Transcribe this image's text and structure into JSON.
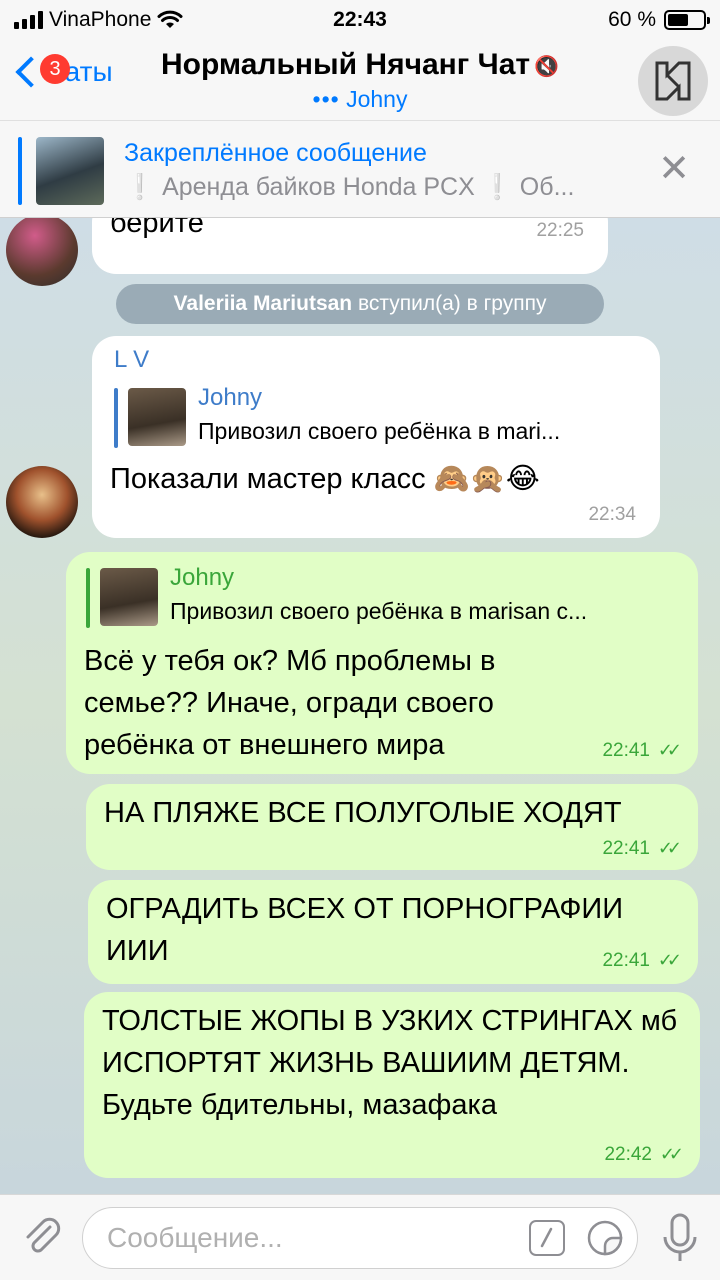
{
  "status_bar": {
    "carrier": "VinaPhone",
    "time": "22:43",
    "battery": "60 %",
    "battery_level": 0.6
  },
  "header": {
    "back_label": "Чаты",
    "unread_badge": "3",
    "chat_title": "Нормальный Нячанг Чат",
    "typing_dots": "•••",
    "typing_user": "Johny"
  },
  "pinned": {
    "title": "Закреплённое сообщение",
    "text": "❕ Аренда байков Honda PCX ❕ Об..."
  },
  "messages": [
    {
      "text": "берите",
      "time": "22:25"
    },
    {
      "service_name": "Valeriia Mariutsan",
      "service_text": " вступил(а) в группу"
    },
    {
      "sender": "L V",
      "reply_name": "Johny",
      "reply_text": "Привозил своего ребёнка в mari...",
      "text": "Показали мастер класс 🙈🙊😂",
      "time": "22:34"
    },
    {
      "reply_name": "Johny",
      "reply_text": "Привозил своего ребёнка в marisan c...",
      "text": "Всё у тебя ок? Мб проблемы в семье?? Иначе, огради своего ребёнка от внешнего мира",
      "time": "22:41",
      "checks": "✓✓"
    },
    {
      "text": "НА ПЛЯЖЕ ВСЕ ПОЛУГОЛЫЕ ХОДЯТ",
      "time": "22:41",
      "checks": "✓✓"
    },
    {
      "text": "ОГРАДИТЬ ВСЕХ ОТ ПОРНОГРАФИИ ИИИ",
      "time": "22:41",
      "checks": "✓✓"
    },
    {
      "text": "ТОЛСТЫЕ ЖОПЫ В УЗКИХ СТРИНГАХ мб ИСПОРТЯТ ЖИЗНЬ ВАШИИМ ДЕТЯМ. Будьте бдительны, мазафака",
      "time": "22:42",
      "checks": "✓✓"
    }
  ],
  "input": {
    "placeholder": "Сообщение..."
  },
  "colors": {
    "accent": "#007aff",
    "outgoing_bubble": "#e1fec6",
    "incoming_bubble": "#ffffff",
    "reply_bar_out": "#3aa63a",
    "badge": "#ff3b30"
  }
}
